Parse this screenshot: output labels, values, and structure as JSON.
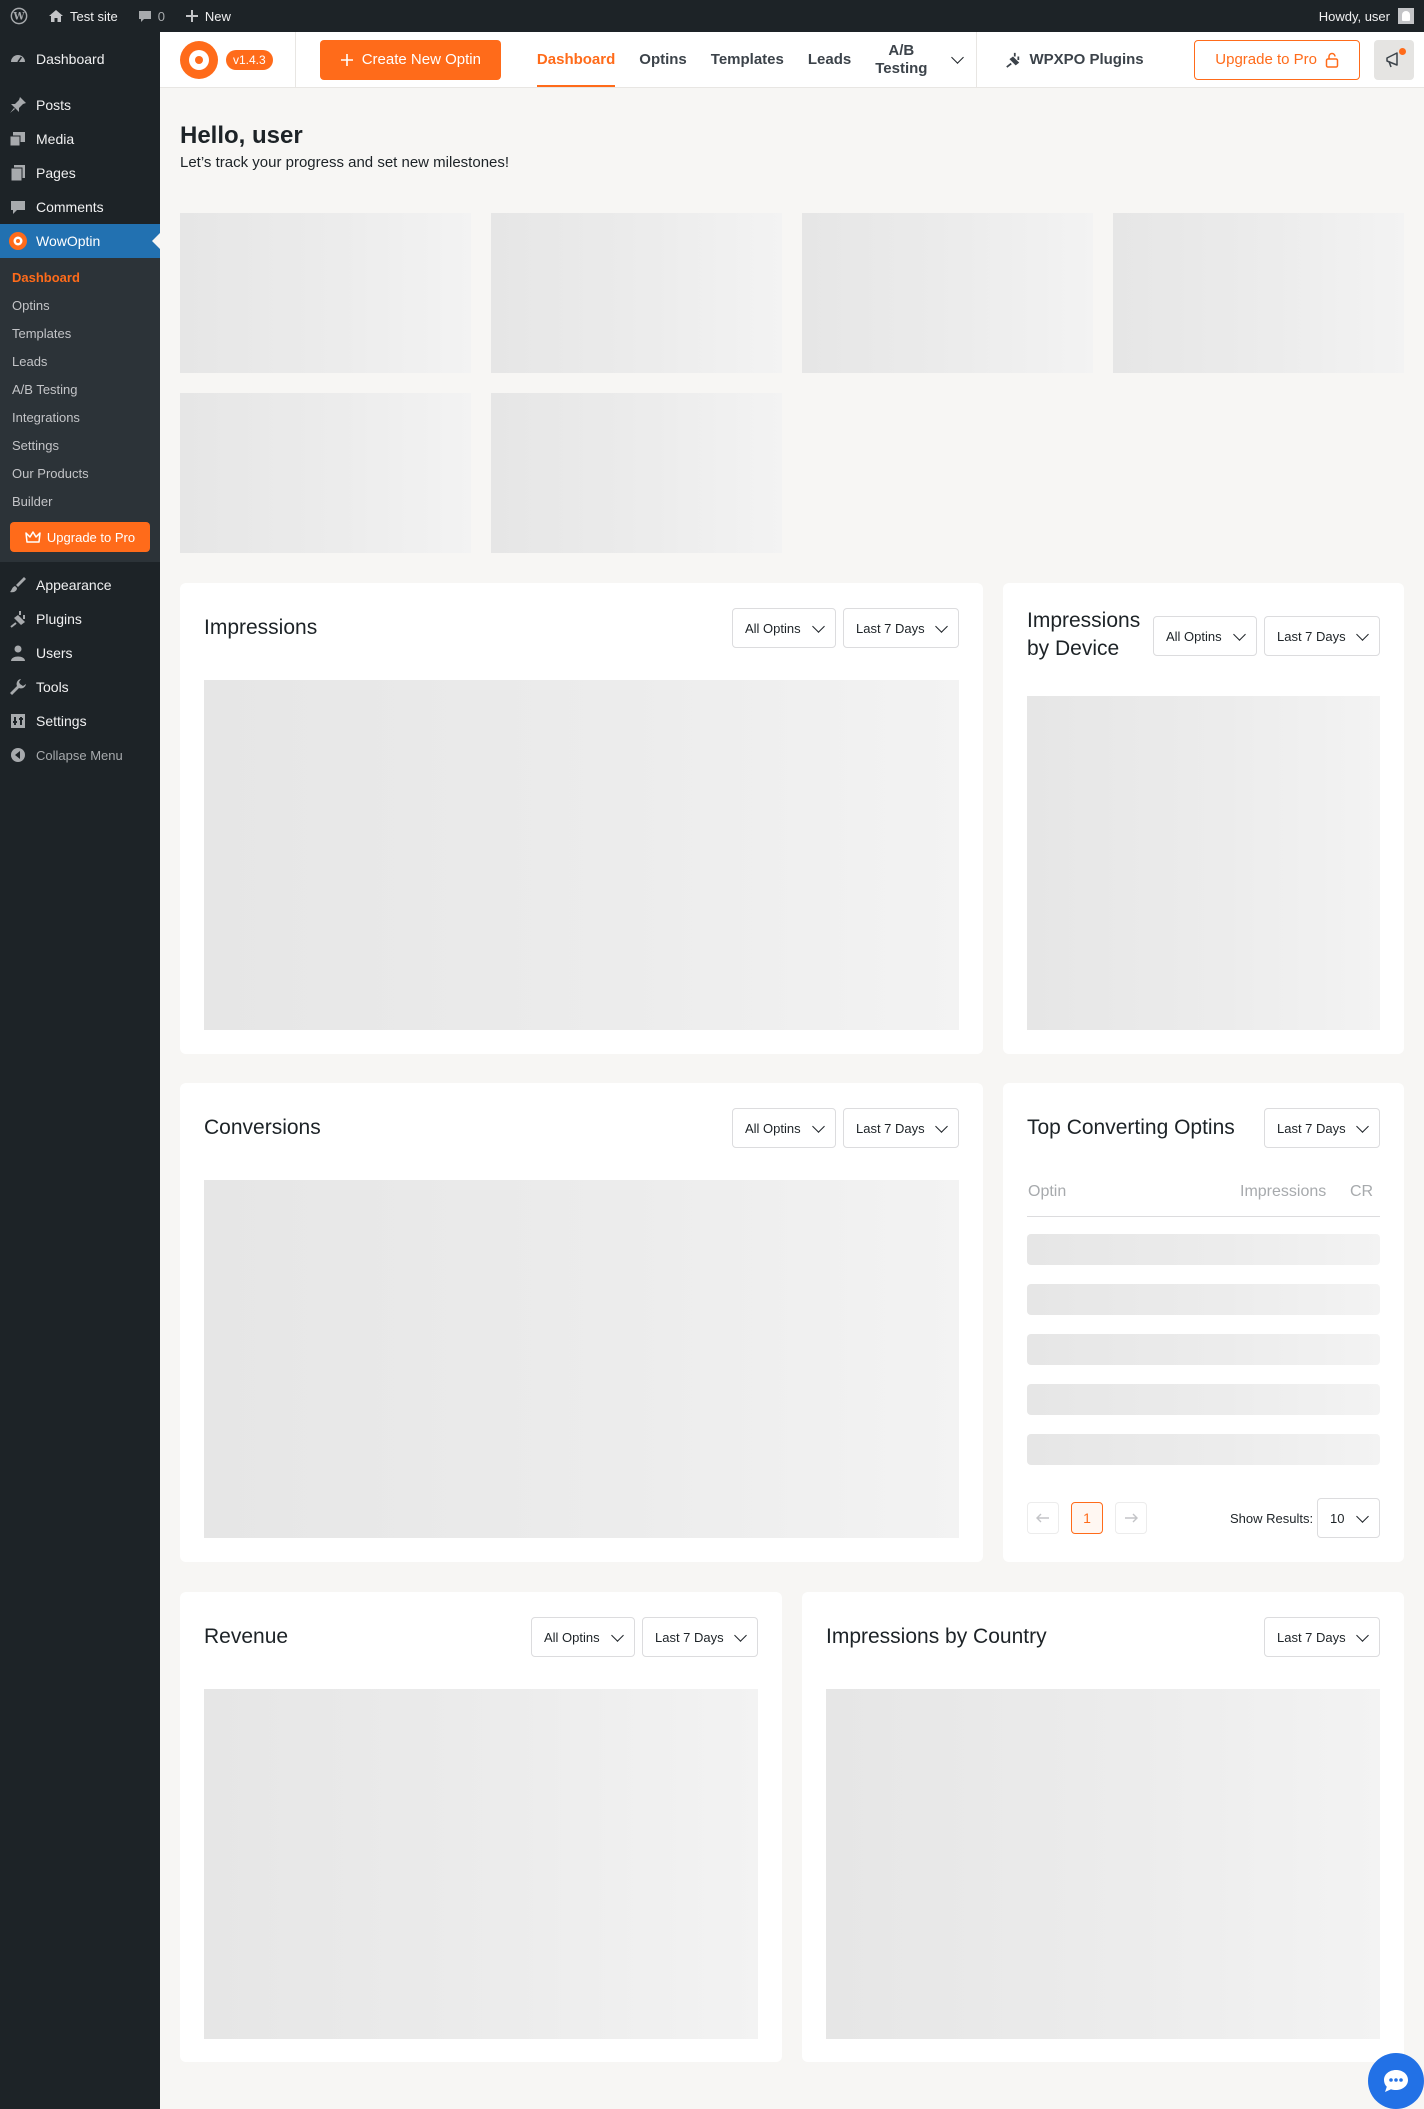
{
  "adminbar": {
    "site_name": "Test site",
    "comments_count": "0",
    "new_label": "New",
    "howdy": "Howdy, user"
  },
  "sidebar": {
    "items_top": [
      {
        "label": "Dashboard",
        "icon": "dashboard-icon"
      }
    ],
    "items_mid": [
      {
        "label": "Posts",
        "icon": "pin-icon"
      },
      {
        "label": "Media",
        "icon": "media-icon"
      },
      {
        "label": "Pages",
        "icon": "pages-icon"
      },
      {
        "label": "Comments",
        "icon": "comment-icon"
      }
    ],
    "active": {
      "label": "WowOptin",
      "icon": "wowoptin-icon"
    },
    "submenu": [
      "Dashboard",
      "Optins",
      "Templates",
      "Leads",
      "A/B Testing",
      "Integrations",
      "Settings",
      "Our Products",
      "Builder"
    ],
    "upgrade_label": "Upgrade to Pro",
    "items_bottom": [
      {
        "label": "Appearance",
        "icon": "brush-icon"
      },
      {
        "label": "Plugins",
        "icon": "plug-icon"
      },
      {
        "label": "Users",
        "icon": "user-icon"
      },
      {
        "label": "Tools",
        "icon": "wrench-icon"
      },
      {
        "label": "Settings",
        "icon": "settings-icon"
      }
    ],
    "collapse_label": "Collapse Menu"
  },
  "header": {
    "version": "v1.4.3",
    "create_label": "Create New Optin",
    "tabs": [
      "Dashboard",
      "Optins",
      "Templates",
      "Leads"
    ],
    "ab_tab_line1": "A/B",
    "ab_tab_line2": "Testing",
    "wpxpo_label": "WPXPO Plugins",
    "upgrade_label": "Upgrade to Pro"
  },
  "greeting": {
    "title": "Hello, user",
    "subtitle": "Let’s track your progress and set new milestones!"
  },
  "cards": {
    "impressions": {
      "title": "Impressions",
      "filter1": "All Optins",
      "filter2": "Last 7 Days"
    },
    "device": {
      "title_line1": "Impressions",
      "title_line2": "by Device",
      "filter1": "All Optins",
      "filter2": "Last 7 Days"
    },
    "conversions": {
      "title": "Conversions",
      "filter1": "All Optins",
      "filter2": "Last 7 Days"
    },
    "top": {
      "title": "Top Converting Optins",
      "filter": "Last 7 Days",
      "col_optin": "Optin",
      "col_impressions": "Impressions",
      "col_cr": "CR",
      "page": "1",
      "show_results_label": "Show Results:",
      "show_results_value": "10"
    },
    "revenue": {
      "title": "Revenue",
      "filter1": "All Optins",
      "filter2": "Last 7 Days"
    },
    "country": {
      "title": "Impressions by Country",
      "filter": "Last 7 Days"
    }
  }
}
